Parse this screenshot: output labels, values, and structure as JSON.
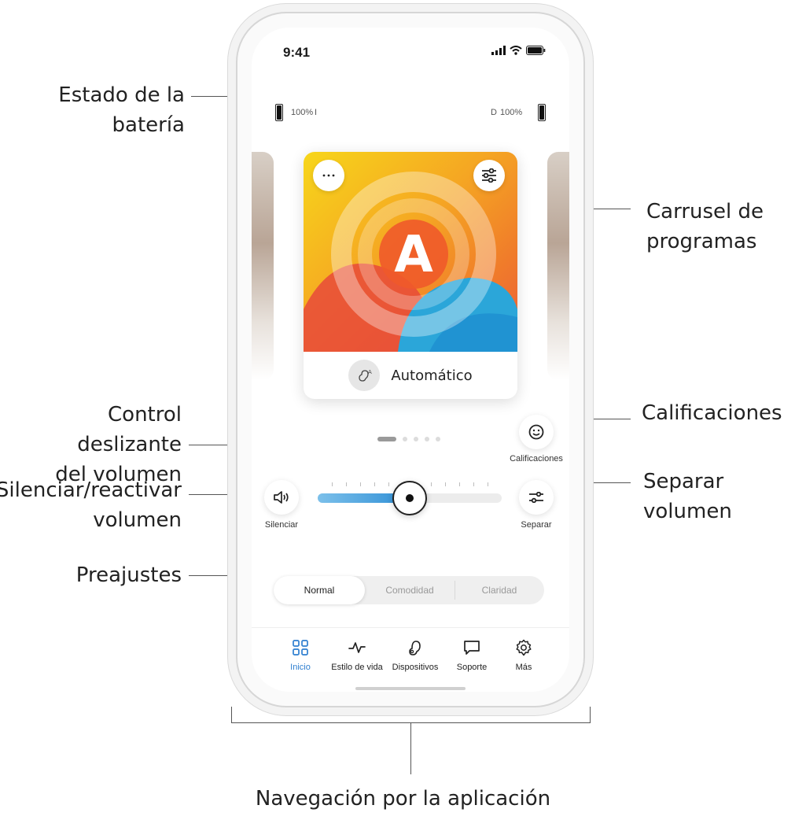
{
  "annotations": {
    "battery_line1": "Estado de la",
    "battery_line2": "batería",
    "carousel_line1": "Carrusel de",
    "carousel_line2": "programas",
    "slider_line1": "Control deslizante",
    "slider_line2": "del volumen",
    "ratings": "Calificaciones",
    "mute_line1": "Silenciar/reactivar",
    "mute_line2": "volumen",
    "split": "Separar volumen",
    "presets": "Preajustes",
    "navigation": "Navegación por la aplicación"
  },
  "status_bar": {
    "time": "9:41",
    "icons": [
      "signal-icon",
      "wifi-icon",
      "battery-icon"
    ]
  },
  "battery": {
    "left_value": "100%",
    "left_side": "I",
    "right_side": "D",
    "right_value": "100%"
  },
  "program": {
    "letter": "A",
    "name": "Automático"
  },
  "pager": {
    "pages": 5,
    "active": 0
  },
  "ratings_button": {
    "label": "Calificaciones"
  },
  "volume": {
    "mute_label": "Silenciar",
    "split_label": "Separar",
    "level_percent": 50
  },
  "presets": {
    "items": [
      "Normal",
      "Comodidad",
      "Claridad"
    ],
    "selected": "Normal"
  },
  "nav": {
    "items": [
      {
        "label": "Inicio",
        "icon": "grid-icon",
        "active": true
      },
      {
        "label": "Estilo de vida",
        "icon": "activity-icon",
        "active": false
      },
      {
        "label": "Dispositivos",
        "icon": "hearing-aid-icon",
        "active": false
      },
      {
        "label": "Soporte",
        "icon": "chat-icon",
        "active": false
      },
      {
        "label": "Más",
        "icon": "gear-icon",
        "active": false
      }
    ]
  },
  "colors": {
    "accent": "#2f7fd0",
    "slider_fill": "#2f8fd6"
  }
}
